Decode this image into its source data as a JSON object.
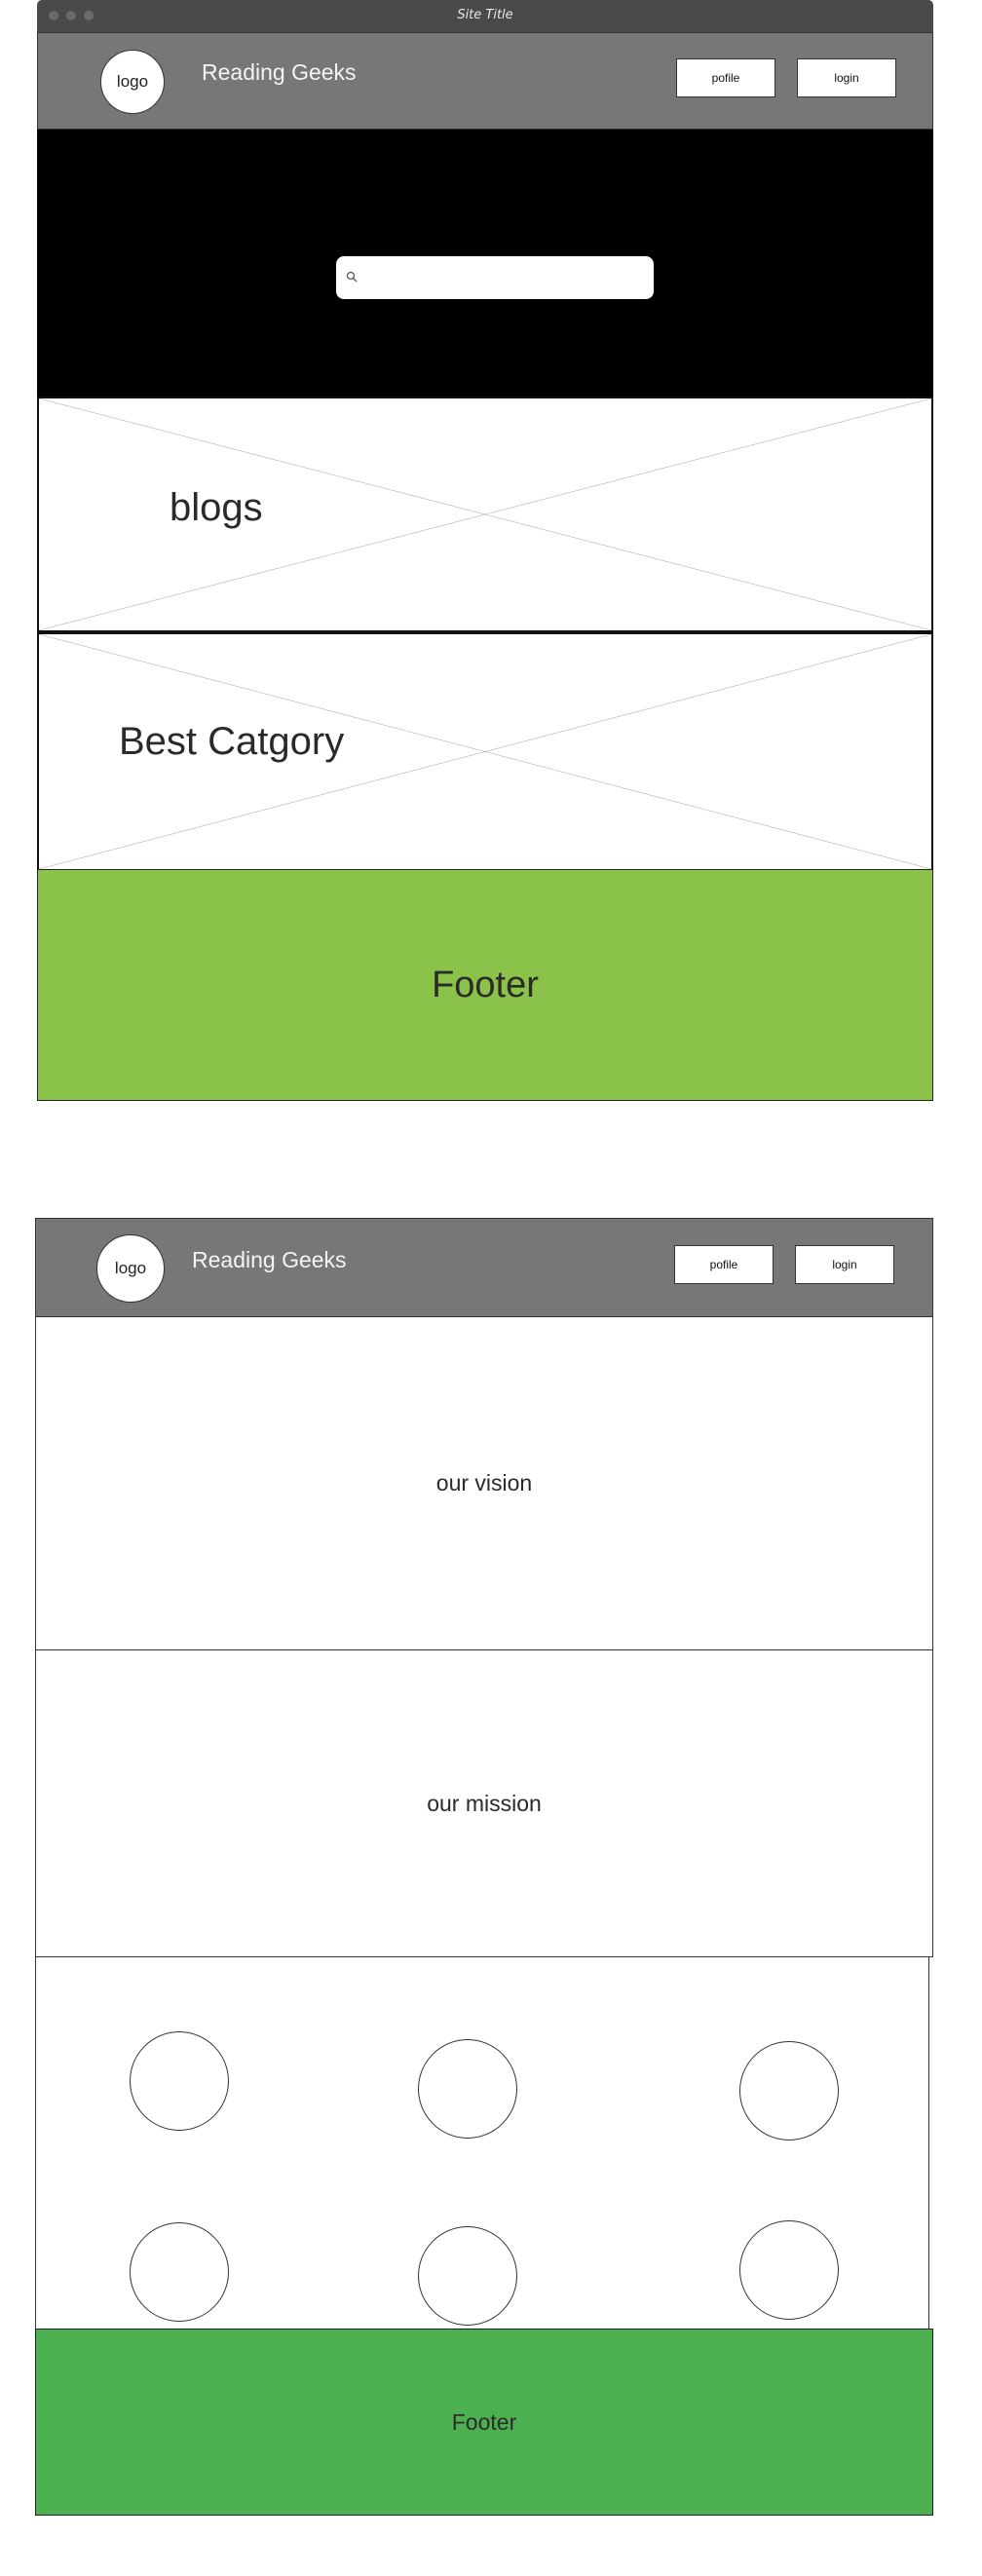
{
  "window": {
    "title": "Site Title"
  },
  "home": {
    "header": {
      "logo": "logo",
      "brand": "Reading Geeks",
      "profile_button": "pofile",
      "login_button": "login"
    },
    "search": {
      "value": "",
      "placeholder": ""
    },
    "sections": {
      "blogs": "blogs",
      "best_category": "Best Catgory"
    },
    "footer": "Footer",
    "colors": {
      "footer": "#8bc34a",
      "header": "#777777",
      "hero": "#000000"
    }
  },
  "about": {
    "header": {
      "logo": "logo",
      "brand": "Reading Geeks",
      "profile_button": "pofile",
      "login_button": "login"
    },
    "vision": "our vision",
    "mission": "our mission",
    "team_member_count": 6,
    "footer": "Footer",
    "colors": {
      "footer": "#4caf50"
    }
  }
}
